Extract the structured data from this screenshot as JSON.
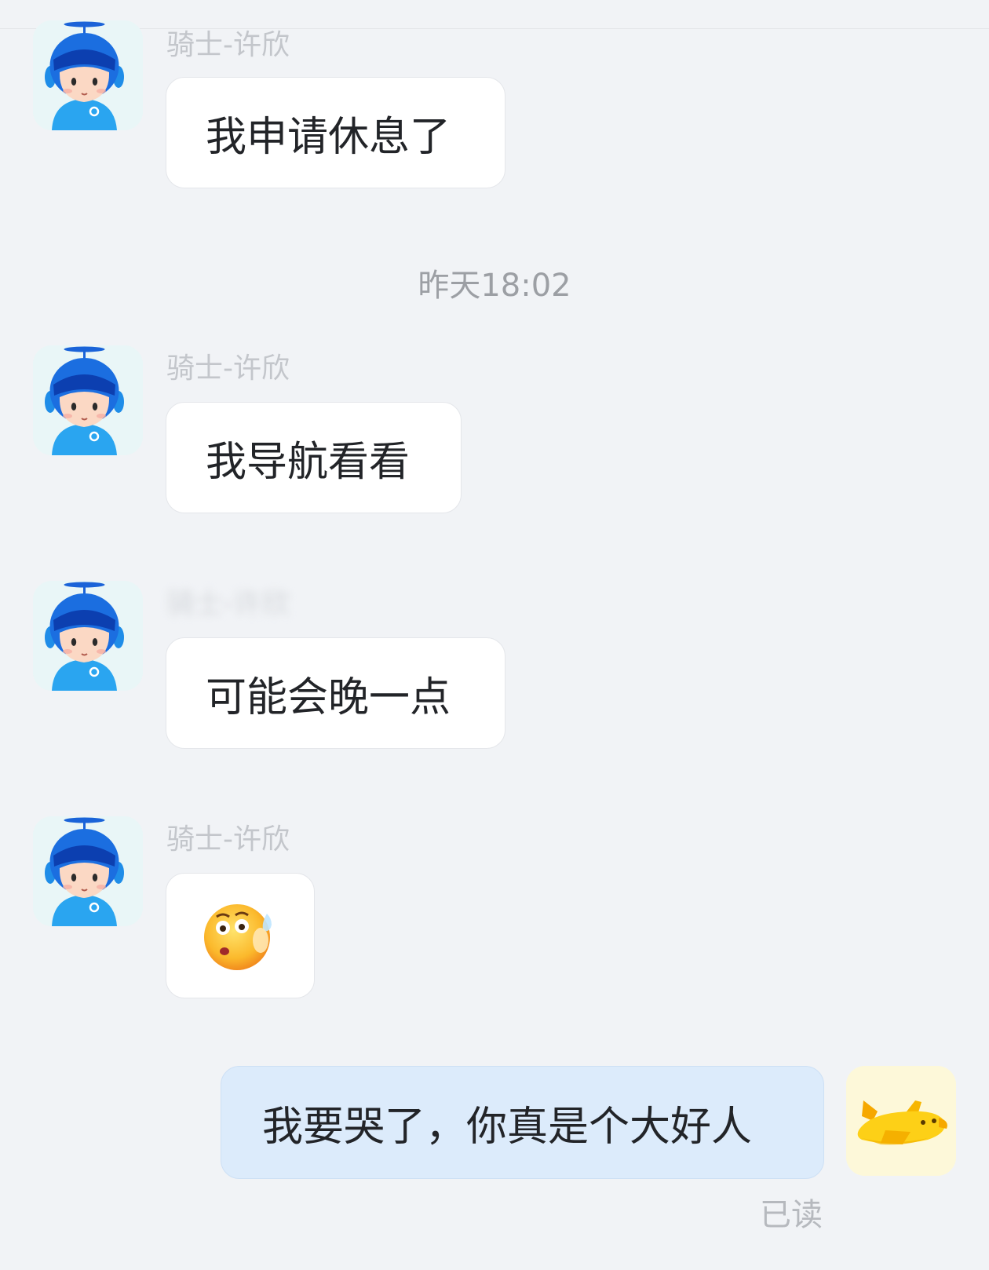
{
  "colors": {
    "background": "#f1f3f6",
    "incoming_bubble": "#ffffff",
    "outgoing_bubble": "#dcebfb",
    "sender_name": "#c3c6cb",
    "timestamp": "#9c9fa4"
  },
  "messages": [
    {
      "sender": "骑士-许欣",
      "text": "我申请休息了",
      "avatar_icon": "rider-mascot-icon"
    },
    {
      "sender": "骑士-许欣",
      "text": "我导航看看",
      "avatar_icon": "rider-mascot-icon"
    },
    {
      "sender": "骑士-许欣",
      "text": "可能会晚一点",
      "avatar_icon": "rider-mascot-icon"
    },
    {
      "sender": "骑士-许欣",
      "emoji_icon": "flushed-sweat-emoji-icon",
      "avatar_icon": "rider-mascot-icon"
    }
  ],
  "timestamp": "昨天18:02",
  "my_message": {
    "text": "我要哭了，你真是个大好人",
    "avatar_icon": "yellow-airplane-icon",
    "status": "已读"
  }
}
